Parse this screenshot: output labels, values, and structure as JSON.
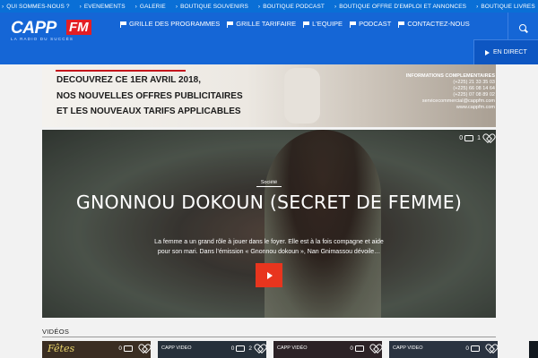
{
  "top_menu": [
    "QUI SOMMES-NOUS ?",
    "EVENEMENTS",
    "GALERIE",
    "BOUTIQUE SOUVENIRS",
    "BOUTIQUE PODCAST",
    "BOUTIQUE OFFRE D'EMPLOI ET ANNONCES",
    "BOUTIQUE LIVRES"
  ],
  "logo": {
    "name_part1": "CAPP",
    "name_part2": "FM",
    "tagline": "LA RADIO DU SUCCÈS"
  },
  "nav": [
    "GRILLE DES PROGRAMMES",
    "GRILLE TARIFAIRE",
    "L'EQUIPE",
    "PODCAST",
    "CONTACTEZ-NOUS"
  ],
  "live_label": "EN DIRECT",
  "banner": {
    "line1": "DECOUVREZ CE 1ER AVRIL 2018,",
    "line2": "NOS NOUVELLES OFFRES PUBLICITAIRES",
    "line3": "ET LES NOUVEAUX TARIFS APPLICABLES",
    "info_title": "INFORMATIONS COMPLEMENTAIRES",
    "info_lines": [
      "(+225) 21 33 35 03",
      "(+225) 66 08 14 64",
      "(+225) 07 08 89 02",
      "servicecommercial@cappfm.com",
      "www.cappfm.com"
    ]
  },
  "hero": {
    "comments": "0",
    "likes": "1",
    "category": "Société",
    "title": "GNONNOU DOKOUN (SECRET DE FEMME)",
    "excerpt": "La femme a un grand rôle à jouer dans le foyer. Elle est à la fois compagne et aide pour son mari. Dans l’émission « Gnonnou dokoun », Nan Gnimassou dévoile…"
  },
  "videos": {
    "label": "VIDÉOS",
    "cards": [
      {
        "tag": "",
        "comments": "0",
        "likes": "",
        "image_text": "Fêtes",
        "bg": "#3a2d22"
      },
      {
        "tag": "CAPP VIDEO",
        "comments": "0",
        "likes": "2",
        "image_text": "",
        "bg": "#26303a"
      },
      {
        "tag": "CAPP VIDÉO",
        "comments": "0",
        "likes": "",
        "image_text": "",
        "bg": "#2c2226"
      },
      {
        "tag": "CAPP VIDEO",
        "comments": "0",
        "likes": "",
        "image_text": "",
        "bg": "#2a3340"
      }
    ]
  },
  "colors": {
    "topbar": "#0a6fd6",
    "header": "#1566d6",
    "accent_red": "#e31e24",
    "play_red": "#e8351e"
  }
}
